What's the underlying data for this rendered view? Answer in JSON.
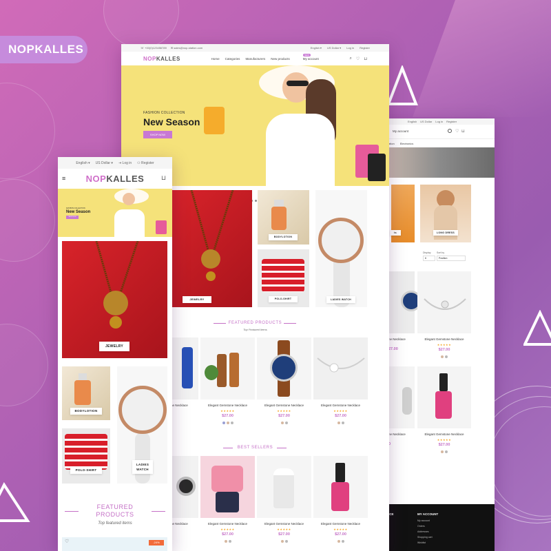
{
  "brand_badge": "NOPKALLES",
  "desktop": {
    "topbar": {
      "phone": "+00(0)123456789",
      "email": "sales@nop-station.com",
      "language": "English",
      "currency": "US Dollar",
      "login": "Log in",
      "register": "Register"
    },
    "logo_a": "NOP",
    "logo_b": "KALLES",
    "nav": [
      "Home",
      "Categories",
      "Manufacturers",
      "New products",
      "My account"
    ],
    "new_tag": "NEW",
    "hero": {
      "kicker": "FASHION COLLECTION",
      "title": "New Season",
      "button": "SHOP NOW"
    },
    "categories": [
      "JEWELRY",
      "BODYLOTION",
      "POLO-SHIRT",
      "LADIES WATCH"
    ],
    "featured": {
      "title": "FEATURED PRODUCTS",
      "subtitle": "Top Featured Items"
    },
    "best_sellers": {
      "title": "BEST SELLERS"
    },
    "product_name": "Elegant Gemstone Necklace",
    "product_price": "$27.00",
    "stars": "★★★★★"
  },
  "back": {
    "topbar": {
      "language": "English",
      "currency": "US Dollar",
      "login": "Log in",
      "register": "Register"
    },
    "nav_item": "My account",
    "sub_nav": [
      "ation",
      "Electronics"
    ],
    "category": "LONG DRESS",
    "category_partial": "ts",
    "display_label": "Display",
    "sort_label": "Sort by",
    "display_value": "6",
    "sort_value": "Position",
    "product_name": "Elegant Gemstone Necklace",
    "product_price": "$27.00",
    "product_name_partial": "ne Necklace",
    "price_partial": "27.00",
    "price_partial2": "0",
    "footer_col1": "ICE",
    "footer_title": "MY ACCOUNT",
    "footer_links": [
      "My account",
      "Orders",
      "Addresses",
      "Shopping cart",
      "Wishlist"
    ]
  },
  "mobile": {
    "topbar": {
      "language": "English",
      "currency": "US Dollar",
      "login": "Log in",
      "register": "Register"
    },
    "logo_a": "NOP",
    "logo_b": "KALLES",
    "hero": {
      "kicker": "FASHION COLLECTION",
      "title": "New Season",
      "button": "SHOP NOW"
    },
    "categories": [
      "JEWELRY",
      "BODYLOTION",
      "POLO-SHIRT",
      "LADIES WATCH"
    ],
    "featured": {
      "title_line1": "FEATURED",
      "title_line2": "PRODUCTS",
      "subtitle": "Top featured items"
    },
    "discount": "-24%"
  },
  "colors": {
    "accent": "#c46fc6",
    "hero_bg": "#f5e27a",
    "badge": "#c68bdc"
  }
}
